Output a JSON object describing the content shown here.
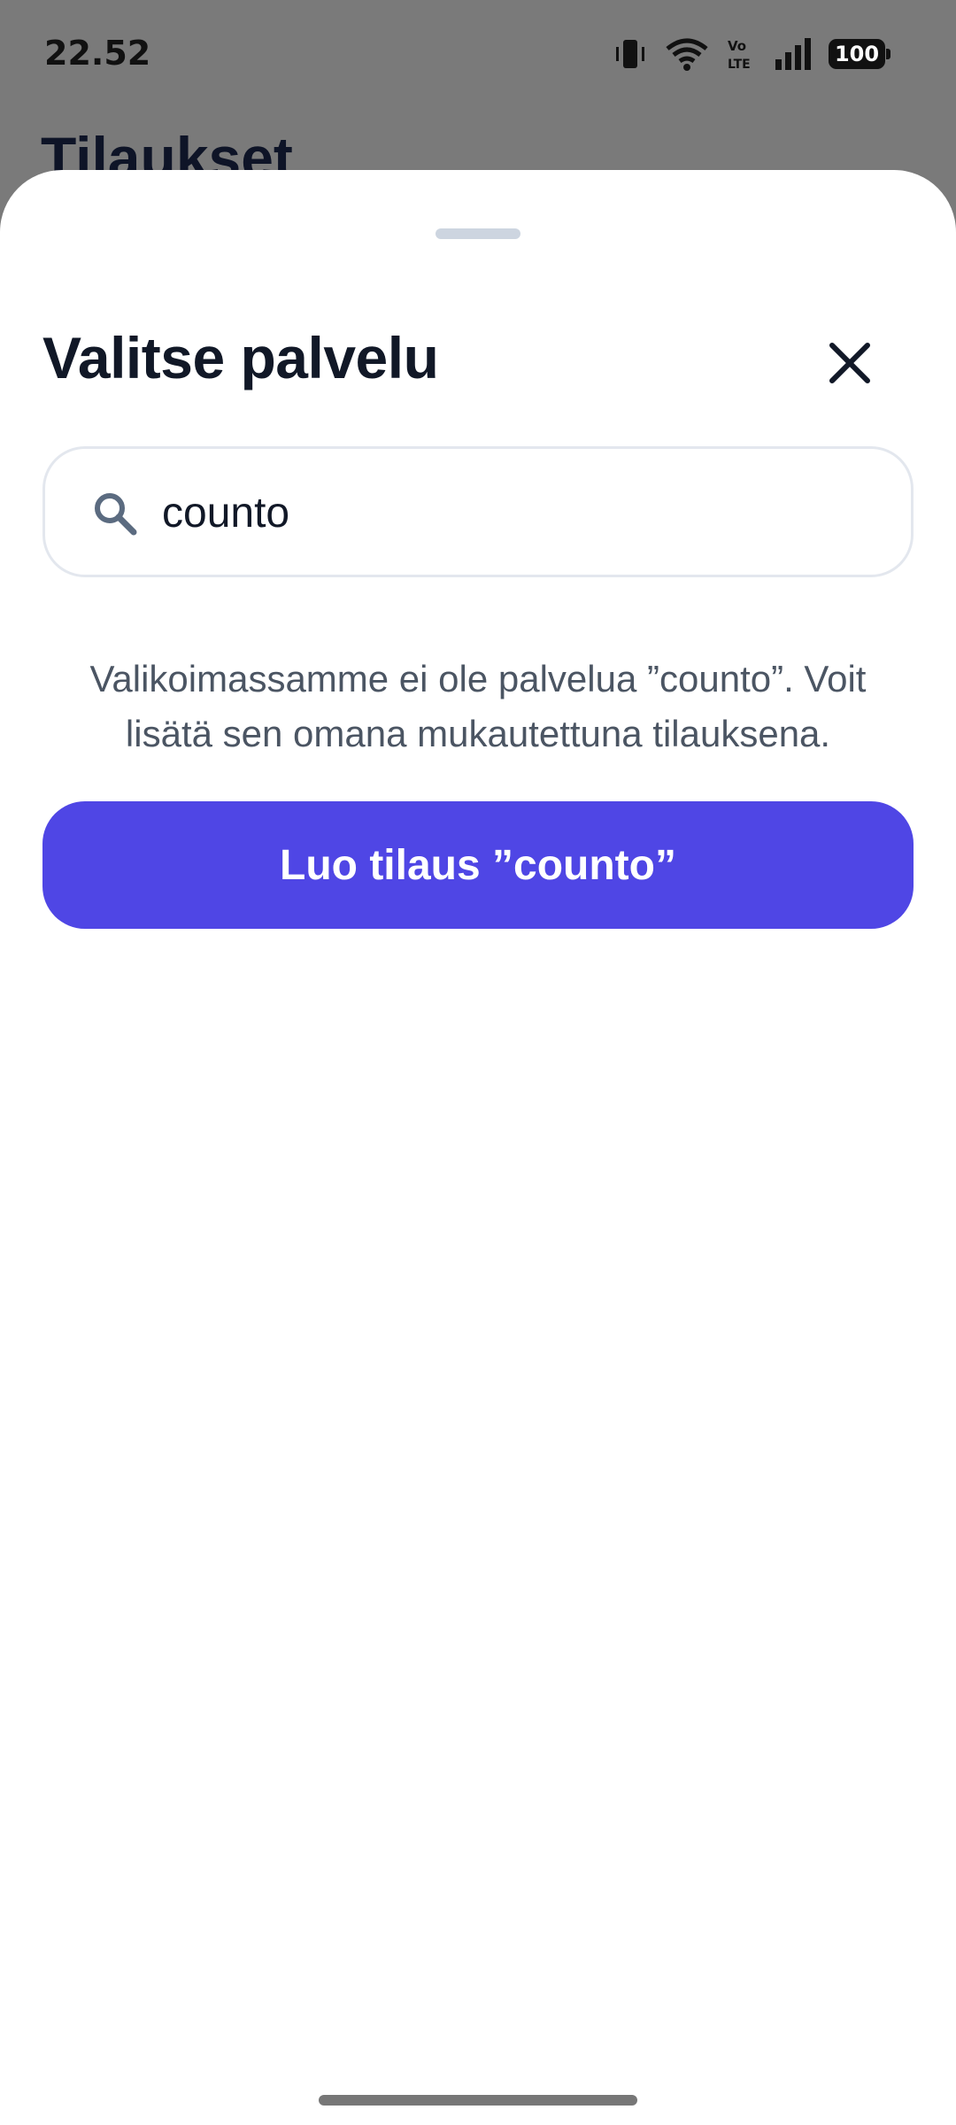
{
  "status_bar": {
    "time": "22.52",
    "battery": "100",
    "icons": [
      "vibrate-icon",
      "wifi-icon",
      "volte-icon",
      "signal-icon",
      "battery-icon"
    ]
  },
  "background": {
    "title": "Tilaukset"
  },
  "sheet": {
    "title": "Valitse palvelu",
    "close_icon": "close-icon",
    "search": {
      "icon": "search-icon",
      "value": "counto"
    },
    "info_text": "Valikoimassamme ei ole palvelua ”counto”. Voit lisätä sen omana mukautettuna tilauksena.",
    "create_button": "Luo tilaus ”counto”"
  },
  "colors": {
    "accent": "#4f46e5",
    "title": "#111827",
    "muted_text": "#4b5563",
    "scrim": "#7a7a7a",
    "sheet": "#ffffff"
  }
}
